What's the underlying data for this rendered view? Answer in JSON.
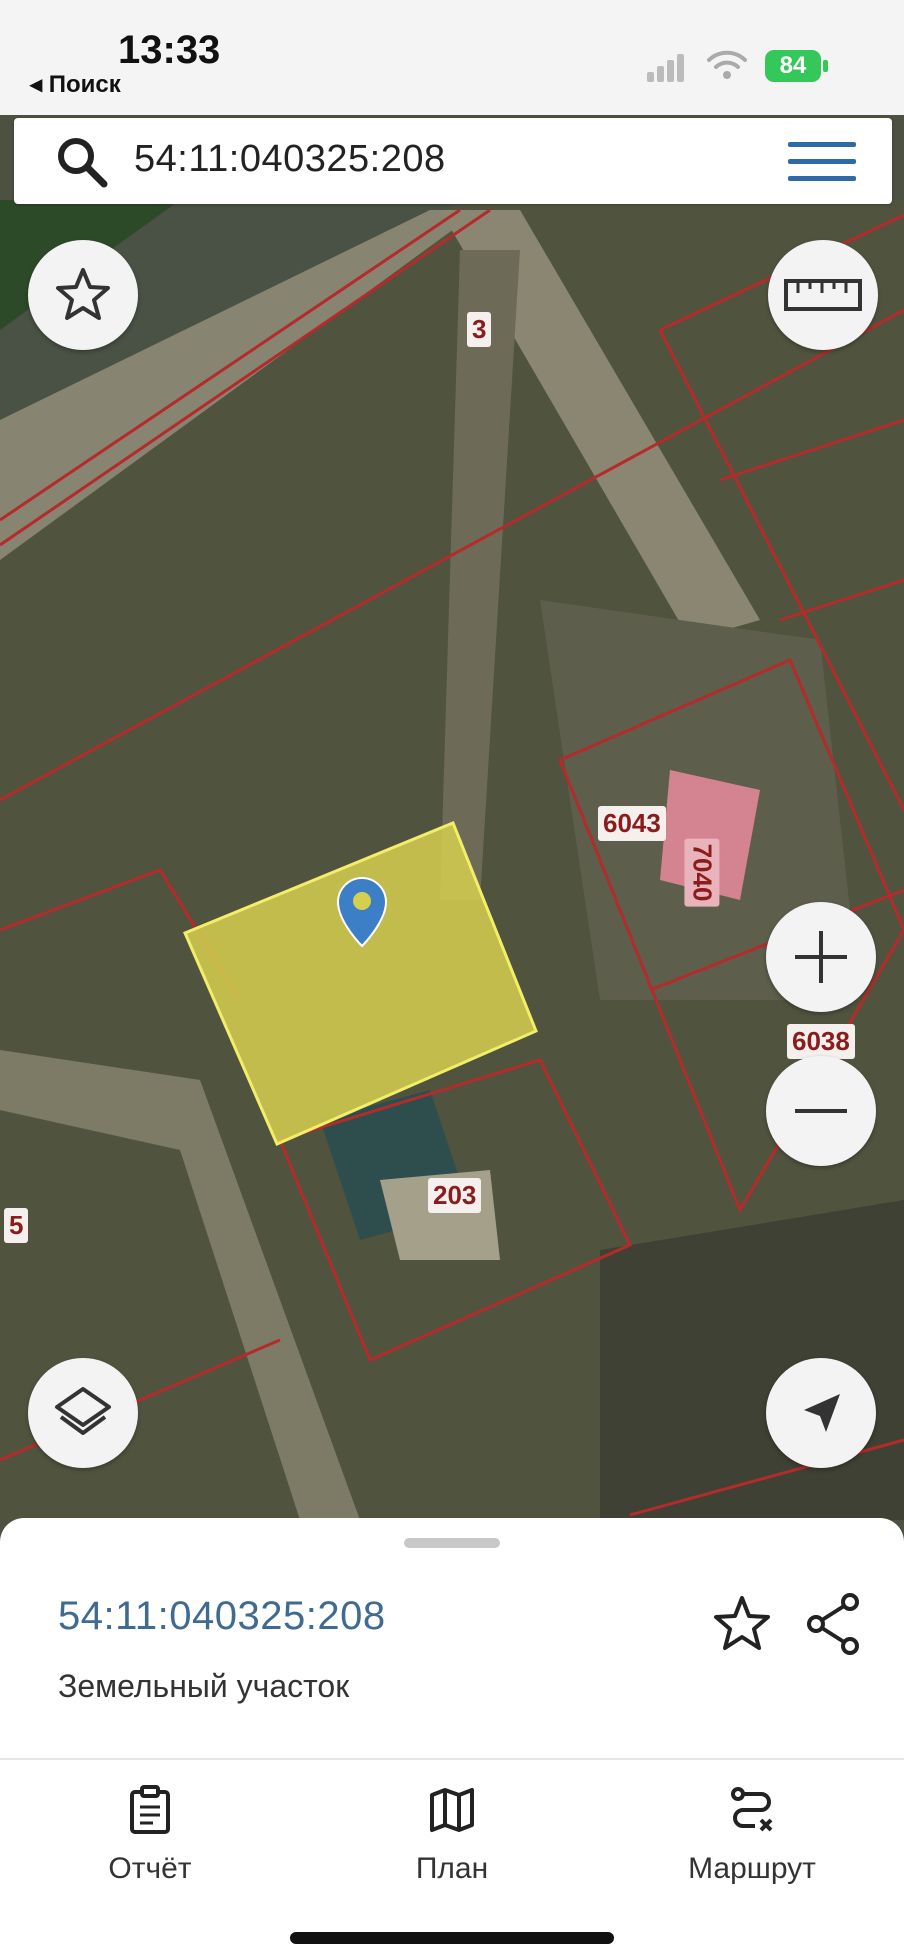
{
  "status_bar": {
    "time": "13:33",
    "back_label": "◂ Поиск",
    "battery": "84"
  },
  "search": {
    "query": "54:11:040325:208"
  },
  "map": {
    "parcel_labels": {
      "p3": "3",
      "p5": "5",
      "p6043": "6043",
      "p7040": "7040",
      "p6038": "6038",
      "p203": "203"
    },
    "colors": {
      "boundary": "#b52a2a",
      "selected_fill": "#d5cf4e",
      "selected_stroke": "#f2ee6a",
      "marker": "#3d7fc6"
    }
  },
  "controls": {
    "favorite": "star-icon",
    "ruler": "ruler-icon",
    "zoom_in": "plus-icon",
    "zoom_out": "minus-icon",
    "layers": "layers-icon",
    "locate": "navigation-arrow-icon"
  },
  "sheet": {
    "cadastral_number": "54:11:040325:208",
    "object_type": "Земельный участок"
  },
  "bottom_tabs": [
    {
      "label": "Отчёт",
      "icon": "report-icon"
    },
    {
      "label": "План",
      "icon": "map-icon"
    },
    {
      "label": "Маршрут",
      "icon": "route-icon"
    }
  ]
}
